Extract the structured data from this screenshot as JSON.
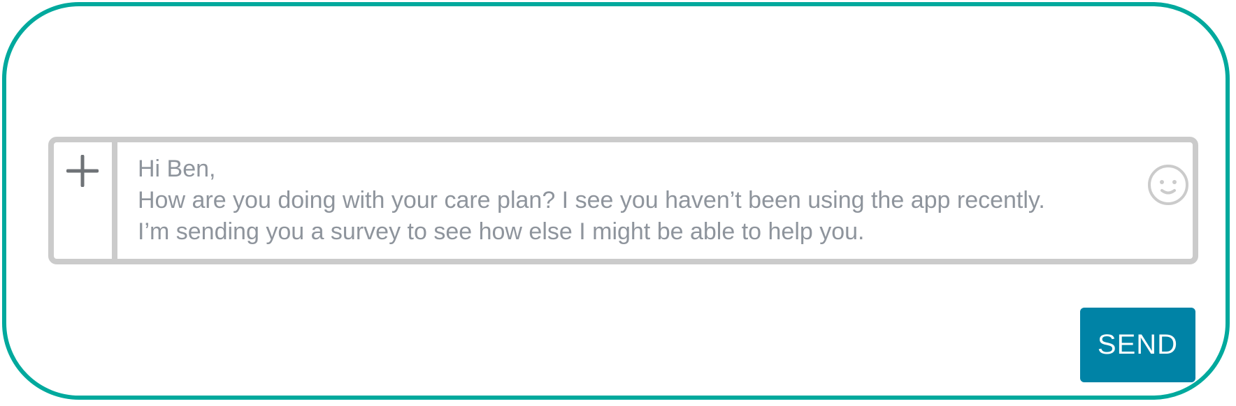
{
  "composer": {
    "message_text": "Hi Ben,\nHow are you doing with your care plan? I see you haven’t been using the app recently.\nI’m sending you a survey to see how else I might be able to help you.",
    "attach_icon": "plus-icon",
    "emoji_icon": "smiley-icon"
  },
  "actions": {
    "send_label": "SEND"
  },
  "colors": {
    "frame_border": "#00a99d",
    "composer_border": "#cbcbcb",
    "message_text": "#8e949c",
    "send_background": "#0083a6",
    "send_text": "#ffffff",
    "icon": "#6f7377"
  }
}
